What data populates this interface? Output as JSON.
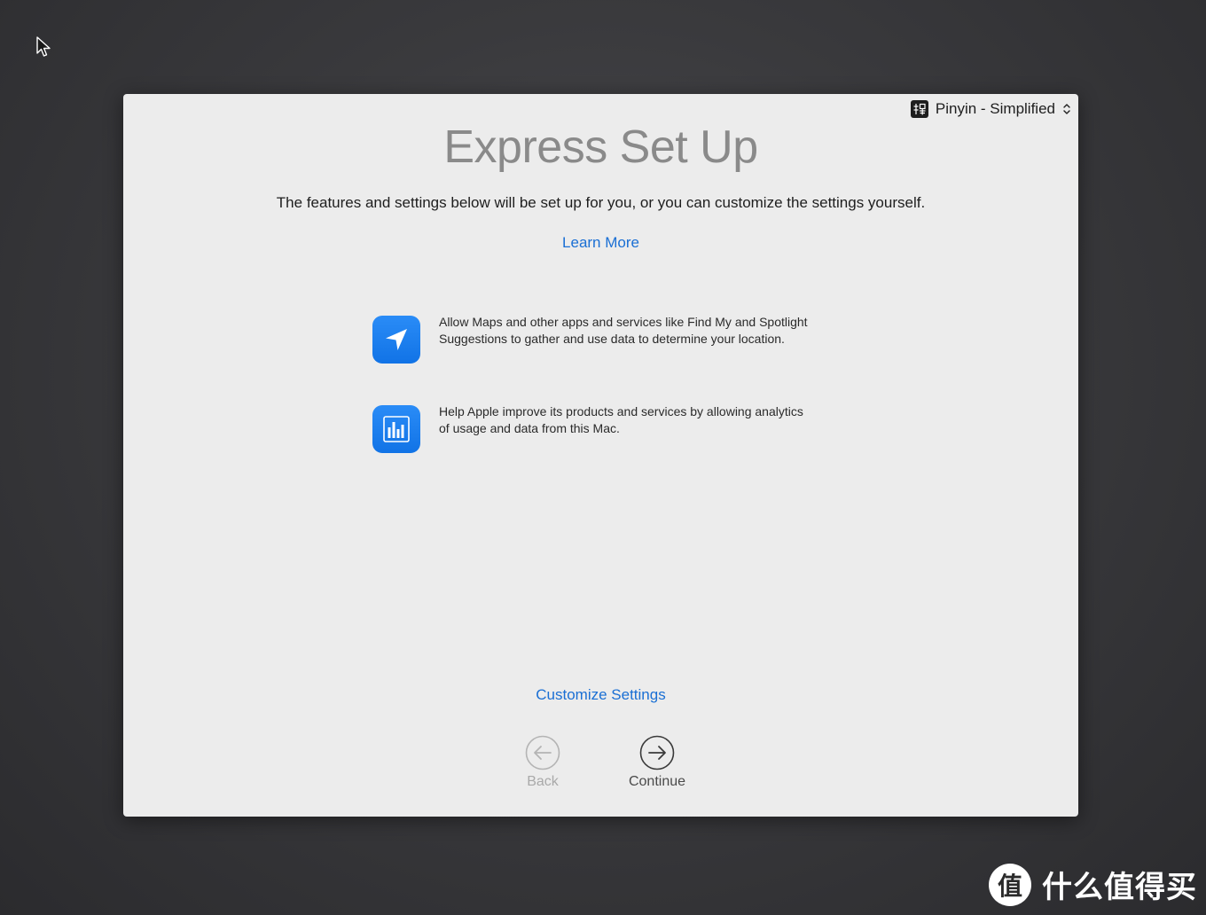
{
  "window": {
    "title": "Express Set Up",
    "subtitle": "The features and settings below will be set up for you, or you can customize the settings yourself.",
    "learn_more": "Learn More",
    "input_menu": {
      "label": "Pinyin - Simplified",
      "icon": "pinyin-input-icon"
    },
    "features": [
      {
        "icon": "location-arrow-icon",
        "text": "Allow Maps and other apps and services like Find My and Spotlight Suggestions to gather and use data to determine your location."
      },
      {
        "icon": "analytics-chart-icon",
        "text": "Help Apple improve its products and services by allowing analytics of usage and data from this Mac."
      }
    ],
    "customize_settings": "Customize Settings",
    "back_label": "Back",
    "continue_label": "Continue"
  },
  "watermark": {
    "logo": "值",
    "text": "什么值得买"
  },
  "colors": {
    "accent": "#1a6fd4",
    "icon_blue": "#1173e6",
    "window_bg": "#ececec",
    "desktop_bg": "#2b2b2e"
  }
}
